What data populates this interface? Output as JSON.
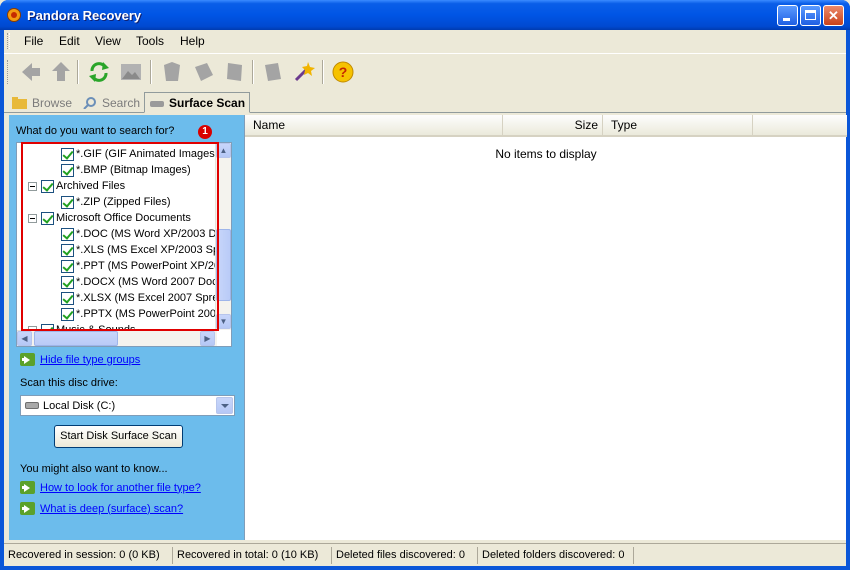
{
  "window": {
    "title": "Pandora Recovery"
  },
  "menu": [
    "File",
    "Edit",
    "View",
    "Tools",
    "Help"
  ],
  "toolbar": {
    "icons": [
      "back-arrow-icon",
      "up-arrow-icon",
      "refresh-icon",
      "image-icon",
      "recover-icon",
      "copy-icon",
      "properties-icon",
      "notes-icon",
      "magic-wand-icon",
      "help-icon"
    ]
  },
  "tabs": [
    "Browse",
    "Search",
    "Surface Scan"
  ],
  "left": {
    "question": "What do you want to search for?",
    "marker": "1",
    "tree": [
      {
        "label": "*.GIF (GIF Animated Images)",
        "indent": 2
      },
      {
        "label": "*.BMP (Bitmap Images)",
        "indent": 2
      },
      {
        "label": "Archived Files",
        "indent": 1,
        "group": true
      },
      {
        "label": "*.ZIP (Zipped Files)",
        "indent": 2
      },
      {
        "label": "Microsoft Office Documents",
        "indent": 1,
        "group": true
      },
      {
        "label": "*.DOC (MS Word XP/2003 Doc",
        "indent": 2
      },
      {
        "label": "*.XLS (MS Excel XP/2003 Spr",
        "indent": 2
      },
      {
        "label": "*.PPT (MS PowerPoint XP/20",
        "indent": 2
      },
      {
        "label": "*.DOCX (MS Word 2007 Doc",
        "indent": 2
      },
      {
        "label": "*.XLSX (MS Excel 2007 Sprea",
        "indent": 2
      },
      {
        "label": "*.PPTX (MS PowerPoint 2007",
        "indent": 2
      },
      {
        "label": "Music & Sounds",
        "indent": 1,
        "group": true
      }
    ],
    "hide_link": "Hide file type groups",
    "drive_label": "Scan this disc drive:",
    "drive_value": "Local Disk (C:)",
    "scan_button": "Start Disk Surface Scan",
    "know_heading": "You might also want to know...",
    "know_links": [
      "How to look for another file type?",
      "What is deep (surface) scan?"
    ]
  },
  "list": {
    "columns": [
      "Name",
      "Size",
      "Type"
    ],
    "empty_message": "No items to display"
  },
  "status": [
    "Recovered in session: 0 (0 KB)",
    "Recovered in total: 0 (10 KB)",
    "Deleted files discovered: 0",
    "Deleted folders discovered: 0"
  ],
  "colors": {
    "left_pane_bg": "#6cbcec",
    "title_blue": "#0055e5",
    "highlight_red": "#e00000"
  }
}
